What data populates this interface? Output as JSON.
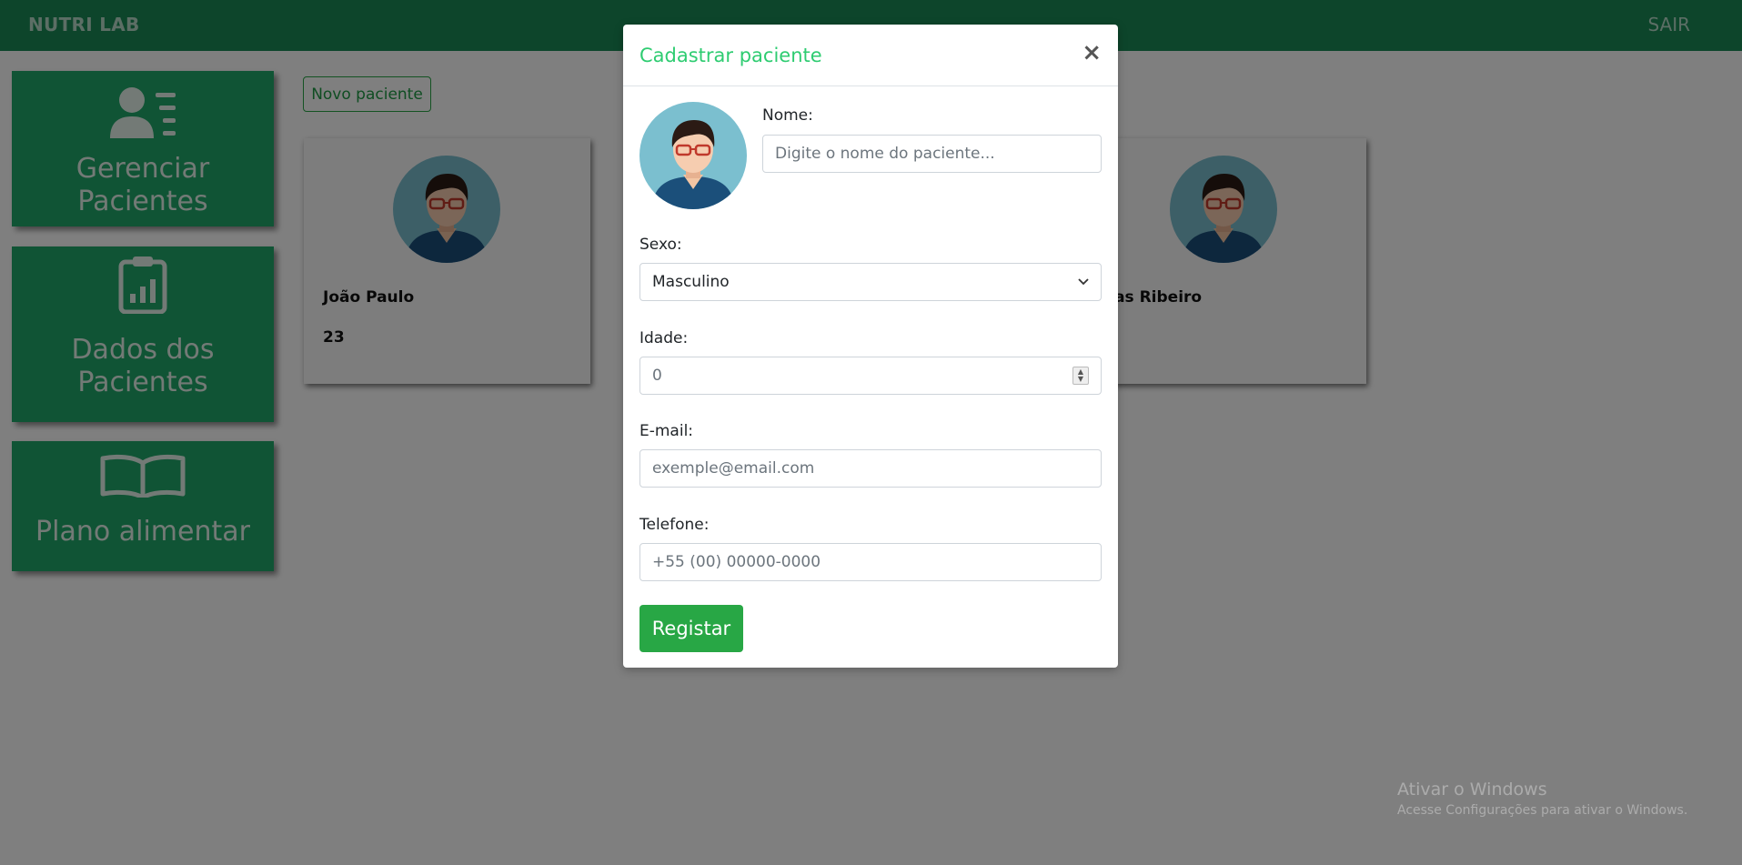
{
  "navbar": {
    "brand": "NUTRI LAB",
    "logout": "SAIR"
  },
  "sidebar": {
    "items": [
      {
        "label": "Gerenciar Pacientes",
        "icon": "user-list-icon"
      },
      {
        "label": "Dados dos Pacientes",
        "icon": "clipboard-chart-icon"
      },
      {
        "label": "Plano alimentar",
        "icon": "open-book-icon"
      }
    ]
  },
  "main": {
    "new_patient_label": "Novo paciente",
    "patients": [
      {
        "name": "João Paulo",
        "age": "23"
      },
      {
        "name": "cas Ribeiro",
        "age": ""
      }
    ]
  },
  "modal": {
    "title": "Cadastrar paciente",
    "close": "×",
    "fields": {
      "nome": {
        "label": "Nome:",
        "placeholder": "Digite o nome do paciente..."
      },
      "sexo": {
        "label": "Sexo:",
        "value": "Masculino"
      },
      "idade": {
        "label": "Idade:",
        "value": "0"
      },
      "email": {
        "label": "E-mail:",
        "placeholder": "exemple@email.com"
      },
      "telefone": {
        "label": "Telefone:",
        "placeholder": "+55 (00) 00000-0000"
      }
    },
    "submit": "Registar"
  },
  "watermark": {
    "title": "Ativar o Windows",
    "subtitle": "Acesse Configurações para ativar o Windows."
  },
  "colors": {
    "navbar": "#1a8a57",
    "sidebar_card": "#20a86a",
    "modal_title": "#2ecc71",
    "submit_button": "#28a745"
  }
}
